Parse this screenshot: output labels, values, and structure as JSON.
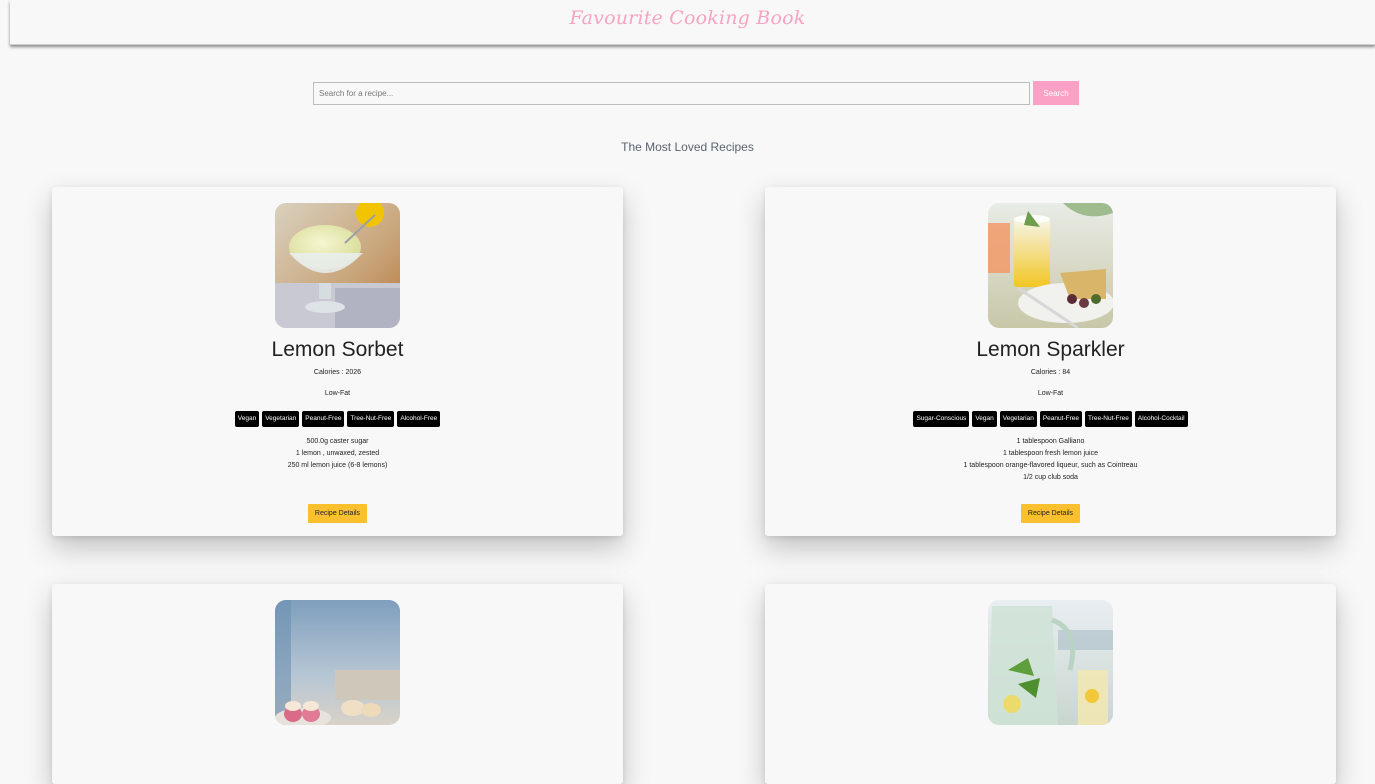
{
  "header": {
    "brand": "Favourite Cooking Book"
  },
  "search": {
    "placeholder": "Search for a recipe...",
    "value": "",
    "button_label": "Search"
  },
  "section": {
    "heading": "The Most Loved Recipes"
  },
  "colors": {
    "brand": "#f7a3c2",
    "search_button": "#fba1c5",
    "details_button": "#fbc02d",
    "tag_background": "#000000"
  },
  "recipes": [
    {
      "title": "Lemon Sorbet",
      "calories_label": "Calories :",
      "calories": "2026",
      "diet": "Low-Fat",
      "health_labels": [
        "Vegan",
        "Vegetarian",
        "Peanut-Free",
        "Tree-Nut-Free",
        "Alcohol-Free"
      ],
      "ingredients": [
        "500.0g caster sugar",
        "1 lemon , unwaxed, zested",
        "250 ml lemon juice (6-8 lemons)"
      ],
      "details_label": "Recipe Details"
    },
    {
      "title": "Lemon Sparkler",
      "calories_label": "Calories :",
      "calories": "84",
      "diet": "Low-Fat",
      "health_labels": [
        "Sugar-Conscious",
        "Vegan",
        "Vegetarian",
        "Peanut-Free",
        "Tree-Nut-Free",
        "Alcohol-Cocktail"
      ],
      "ingredients": [
        "1 tablespoon Galliano",
        "1 tablespoon fresh lemon juice",
        "1 tablespoon orange-flavored liqueur, such as Cointreau",
        "1/2 cup club soda"
      ],
      "details_label": "Recipe Details"
    }
  ]
}
